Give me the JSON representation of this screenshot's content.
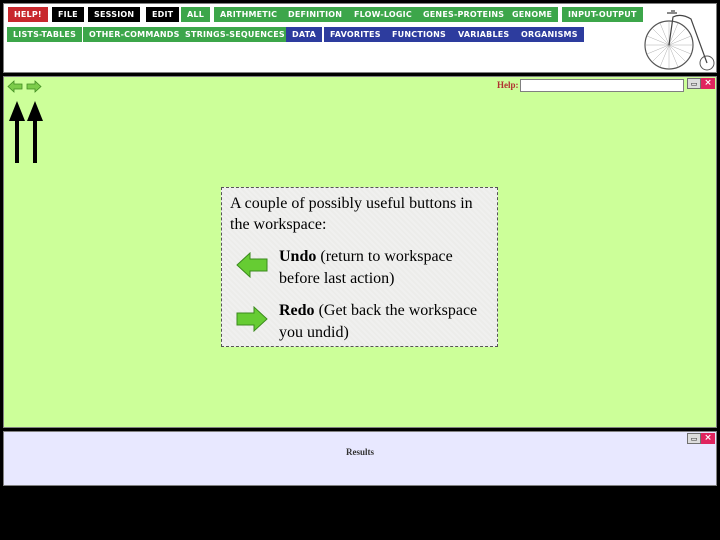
{
  "toolbar": {
    "row1": [
      {
        "label": "HELP!",
        "color": "red",
        "icon": "none"
      },
      {
        "label": "FILE",
        "color": "black"
      },
      {
        "label": "SESSION",
        "color": "black"
      },
      {
        "label": "EDIT",
        "color": "black"
      },
      {
        "label": "ALL",
        "color": "green"
      },
      {
        "label": "ARITHMETIC",
        "color": "green"
      },
      {
        "label": "DEFINITION",
        "color": "green"
      },
      {
        "label": "FLOW-LOGIC",
        "color": "green"
      },
      {
        "label": "GENES-PROTEINS",
        "color": "green"
      },
      {
        "label": "GENOME",
        "color": "green"
      },
      {
        "label": "INPUT-OUTPUT",
        "color": "green"
      }
    ],
    "row2": [
      {
        "label": "LISTS-TABLES",
        "color": "green"
      },
      {
        "label": "OTHER-COMMANDS",
        "color": "green"
      },
      {
        "label": "STRINGS-SEQUENCES",
        "color": "green"
      },
      {
        "label": "DATA",
        "color": "blue"
      },
      {
        "label": "FAVORITES",
        "color": "blue"
      },
      {
        "label": "FUNCTIONS",
        "color": "blue"
      },
      {
        "label": "VARIABLES",
        "color": "blue"
      },
      {
        "label": "ORGANISMS",
        "color": "blue"
      }
    ]
  },
  "workspace": {
    "help_label": "Help:",
    "help_value": "",
    "min_glyph": "▭",
    "close_glyph": "×"
  },
  "info": {
    "heading": "A couple of possibly useful buttons in the workspace:",
    "undo": {
      "title": "Undo",
      "rest": " (return to workspace before last action)"
    },
    "redo": {
      "title": "Redo",
      "rest": " (Get back the workspace you undid)"
    }
  },
  "results": {
    "label": "Results",
    "min_glyph": "▭",
    "close_glyph": "×"
  },
  "colors": {
    "workspace_bg": "#ccff99",
    "results_bg": "#e8e8ff",
    "arrow_green": "#66cc33"
  }
}
